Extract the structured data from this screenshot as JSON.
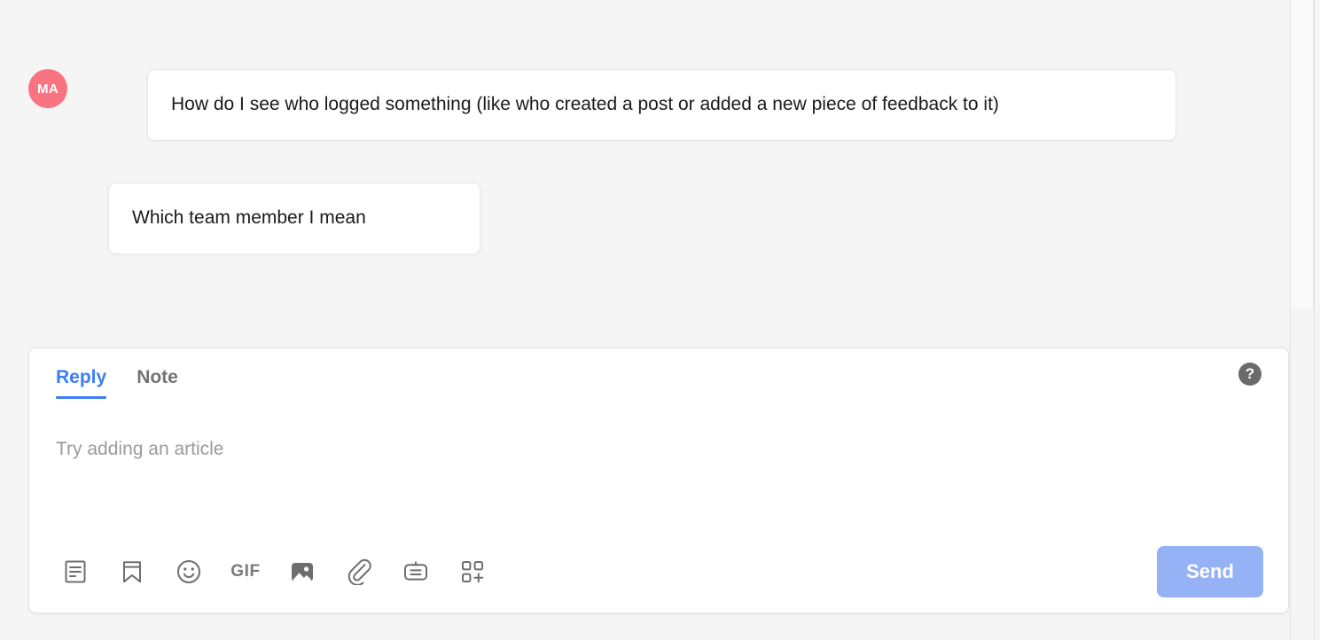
{
  "conversation": {
    "messages": [
      {
        "author_initials": "MA",
        "author_avatar_color": "#fa7381",
        "text": "How do I see who logged something (like who created a post or added a new piece of feedback to it)"
      },
      {
        "author_initials": "",
        "text": "Which team member I mean"
      }
    ]
  },
  "composer": {
    "tabs": [
      {
        "label": "Reply",
        "active": true
      },
      {
        "label": "Note",
        "active": false
      }
    ],
    "active_tab_color": "#3b7ef5",
    "help_icon_label": "?",
    "input": {
      "value": "",
      "placeholder": "Try adding an article"
    },
    "toolbar": {
      "icons": [
        {
          "name": "article-icon",
          "label": "Article"
        },
        {
          "name": "saved-reply-icon",
          "label": "Saved reply"
        },
        {
          "name": "emoji-icon",
          "label": "Emoji"
        },
        {
          "name": "gif-icon",
          "label": "GIF"
        },
        {
          "name": "image-icon",
          "label": "Image"
        },
        {
          "name": "attachment-icon",
          "label": "Attachment"
        },
        {
          "name": "card-icon",
          "label": "Card"
        },
        {
          "name": "apps-add-icon",
          "label": "Apps"
        }
      ],
      "gif_label": "GIF"
    },
    "send": {
      "label": "Send",
      "color": "#94b2f5"
    }
  }
}
